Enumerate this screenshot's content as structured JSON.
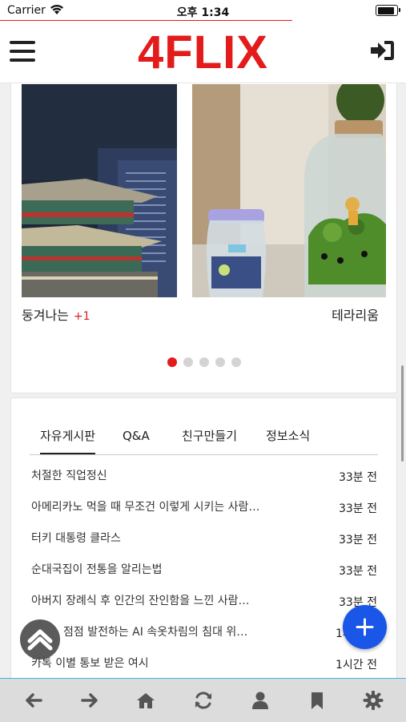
{
  "status_bar": {
    "carrier": "Carrier",
    "time": "오후 1:34",
    "battery_level": 0.95
  },
  "app": {
    "logo": "4FLIX"
  },
  "carousel": {
    "slides": [
      {
        "caption": "둥겨나는",
        "count": "+1"
      },
      {
        "caption": "테라리움"
      }
    ],
    "dot_count": 5,
    "active_dot": 0
  },
  "board": {
    "tabs": [
      {
        "label": "자유게시판"
      },
      {
        "label": "Q&A"
      },
      {
        "label": "친구만들기"
      },
      {
        "label": "정보소식"
      }
    ],
    "posts": [
      {
        "title": "처절한 직업정신",
        "time": "33분 전"
      },
      {
        "title": "아메리카노 먹을 때 무조건 이렇게 시키는 사람…",
        "time": "33분 전"
      },
      {
        "title": "터키 대통령 클라스",
        "time": "33분 전"
      },
      {
        "title": "순대국집이 전통을 알리는법",
        "time": "33분 전"
      },
      {
        "title": "아버지 장례식 후 인간의 잔인함을 느낀 사람…",
        "time": "33분 전"
      },
      {
        "title": "점점 발전하는 AI 속옷차림의 침대 위…",
        "time": "1시간 전"
      },
      {
        "title": "카톡 이별 통보 받은 여시",
        "time": "1시간 전"
      }
    ]
  },
  "colors": {
    "brand": "#e31b1b",
    "fab": "#1a56e8",
    "bottom_bar": "#dcdcdc"
  },
  "bottom_nav": [
    "back-icon",
    "forward-icon",
    "home-icon",
    "refresh-icon",
    "user-icon",
    "bookmark-icon",
    "settings-icon"
  ]
}
